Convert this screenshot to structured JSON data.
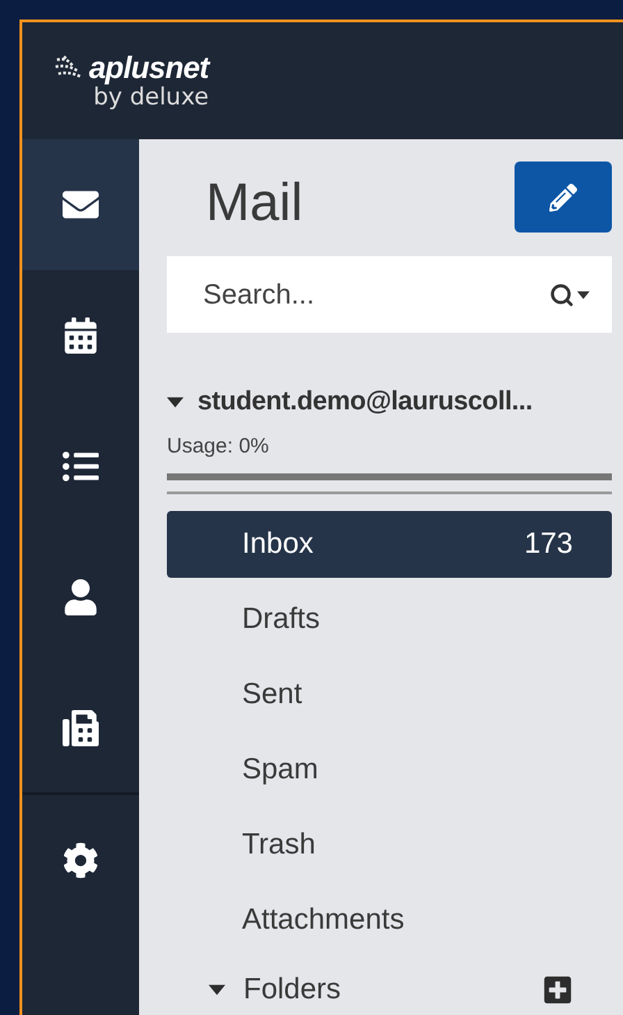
{
  "header": {
    "logo_name": "aplusnet",
    "logo_tagline": "by deluxe"
  },
  "rail": [
    {
      "kind": "mail",
      "selected": true
    },
    {
      "kind": "calendar",
      "selected": false
    },
    {
      "kind": "list",
      "selected": false
    },
    {
      "kind": "contact",
      "selected": false
    },
    {
      "kind": "fax",
      "selected": false
    },
    {
      "kind": "settings",
      "selected": false
    }
  ],
  "title": "Mail",
  "search": {
    "placeholder": "Search..."
  },
  "account": {
    "name": "student.demo@lauruscoll...",
    "expanded": true,
    "usage_label": "Usage: 0%",
    "level": 0
  },
  "folders": [
    {
      "label": "Inbox",
      "count": "173",
      "selected": true
    },
    {
      "label": "Drafts",
      "selected": false
    },
    {
      "label": "Sent",
      "selected": false
    },
    {
      "label": "Spam",
      "selected": false
    },
    {
      "label": "Trash",
      "selected": false
    },
    {
      "label": "Attachments",
      "selected": false
    }
  ],
  "folders_section": {
    "label": "Folders",
    "expanded": true
  }
}
